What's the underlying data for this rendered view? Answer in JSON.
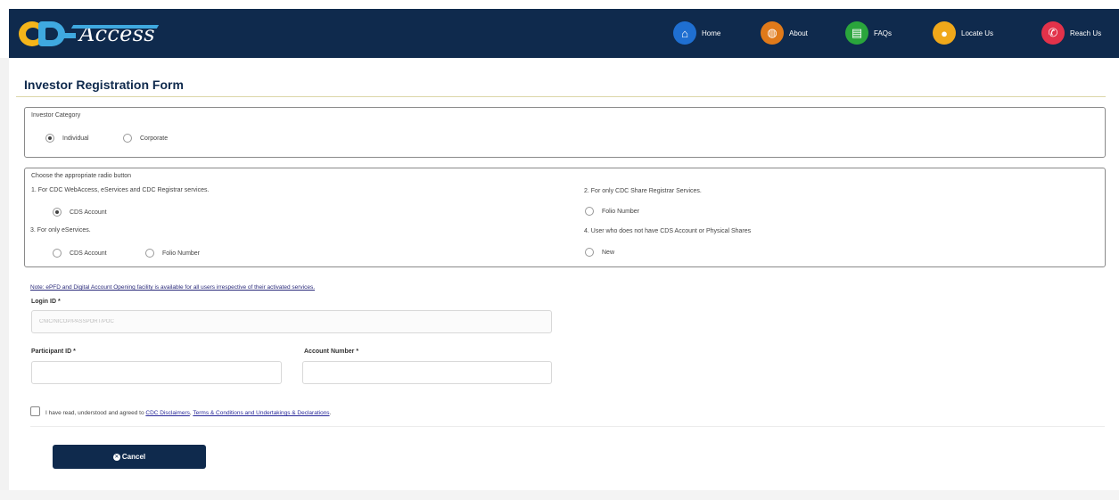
{
  "app": {
    "logo_text": "Access",
    "logo_letters": "CDC"
  },
  "nav": [
    {
      "label": "Home",
      "icon": "home-icon",
      "color": "#1f6fd1",
      "glyph": "⌂"
    },
    {
      "label": "About",
      "icon": "people-icon",
      "color": "#e07a1a",
      "glyph": "◍"
    },
    {
      "label": "FAQs",
      "icon": "chat-icon",
      "color": "#2aa53c",
      "glyph": "▤"
    },
    {
      "label": "Locate Us",
      "icon": "location-pin-icon",
      "color": "#f0a81a",
      "glyph": "●"
    },
    {
      "label": "Reach Us",
      "icon": "phone-icon",
      "color": "#e2324a",
      "glyph": "✆"
    }
  ],
  "form": {
    "title": "Investor Registration Form",
    "category": {
      "legend": "Investor Category",
      "options": [
        {
          "label": "Individual",
          "checked": true
        },
        {
          "label": "Corporate",
          "checked": false
        }
      ]
    },
    "choose": {
      "legend": "Choose the appropriate radio button",
      "group1": {
        "title": "1. For CDC WebAccess, eServices and CDC Registrar services.",
        "option": "CDS Account",
        "checked": true
      },
      "group2": {
        "title": "2. For only CDC Share Registrar Services.",
        "option": "Folio Number",
        "checked": false
      },
      "group3": {
        "title": "3. For only eServices.",
        "options": [
          "CDS Account",
          "Folio Number"
        ]
      },
      "group4": {
        "title": "4. User who does not have CDS Account or Physical Shares",
        "option": "New",
        "checked": false
      }
    },
    "note": "Note: ePFD and Digital Account Opening facility is available for all users irrespective of their activated services.",
    "login_id": {
      "label": "Login ID *",
      "placeholder": "CNIC/NICOP/PASSPORT/POC"
    },
    "participant_id": {
      "label": "Participant ID *",
      "value": ""
    },
    "account_number": {
      "label": "Account Number *",
      "value": ""
    },
    "agreement": {
      "prefix": "I have read, understood and agreed to ",
      "link1": "CDC Disclaimers",
      "sep1": ", ",
      "link2": "Terms & Conditions and Undertakings & Declarations",
      "suffix": "."
    },
    "cancel_label": "Cancel"
  }
}
